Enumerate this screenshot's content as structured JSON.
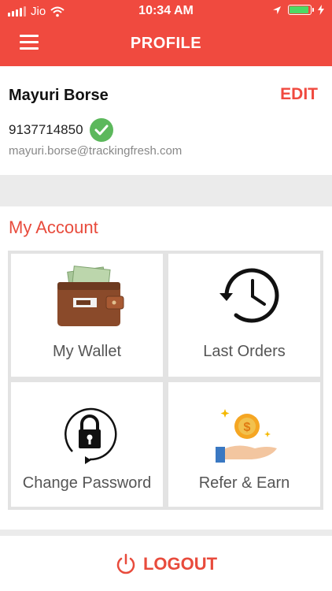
{
  "status_bar": {
    "carrier": "Jio",
    "time": "10:34 AM",
    "icons": [
      "signal-icon",
      "wifi-icon",
      "location-icon",
      "battery-icon",
      "charging-icon"
    ]
  },
  "header": {
    "title": "PROFILE",
    "menu_icon": "hamburger-menu-icon",
    "accent_color": "#f04a3f"
  },
  "profile": {
    "name": "Mayuri Borse",
    "edit_label": "EDIT",
    "phone": "9137714850",
    "phone_verified_icon": "verified-check-icon",
    "email": "mayuri.borse@trackingfresh.com"
  },
  "account": {
    "title": "My Account",
    "items": [
      {
        "label": "My Wallet",
        "icon": "wallet-icon"
      },
      {
        "label": "Last Orders",
        "icon": "history-icon"
      },
      {
        "label": "Change Password",
        "icon": "lock-icon"
      },
      {
        "label": "Refer & Earn",
        "icon": "refer-earn-icon"
      }
    ]
  },
  "logout": {
    "label": "LOGOUT",
    "icon": "power-icon"
  }
}
